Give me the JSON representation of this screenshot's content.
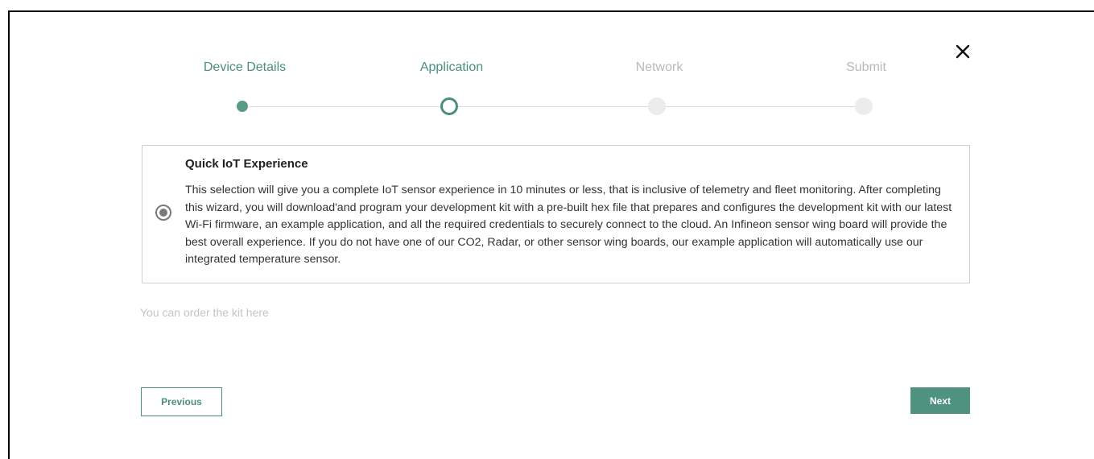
{
  "wizard": {
    "steps": [
      {
        "label": "Device Details",
        "state": "done"
      },
      {
        "label": "Application",
        "state": "active"
      },
      {
        "label": "Network",
        "state": "pending"
      },
      {
        "label": "Submit",
        "state": "pending"
      }
    ],
    "close_icon": "close-icon"
  },
  "option": {
    "title": "Quick IoT Experience",
    "selected": true,
    "description": "This selection will give you a complete IoT sensor experience in 10 minutes or less, that is inclusive of telemetry and fleet monitoring. After completing this wizard, you will download'and program your development kit with a pre-built hex file that prepares and configures the development kit with our latest Wi-Fi firmware, an example application, and all the required credentials to securely connect to the cloud. An Infineon sensor wing board will provide the best overall experience. If you do not have one of our CO2, Radar, or other sensor wing boards, our example application will automatically use our integrated temperature sensor."
  },
  "order_link": "You can order the kit here",
  "buttons": {
    "previous": "Previous",
    "next": "Next"
  },
  "colors": {
    "accent": "#4a8f7e",
    "pending": "#b9b9b9"
  }
}
